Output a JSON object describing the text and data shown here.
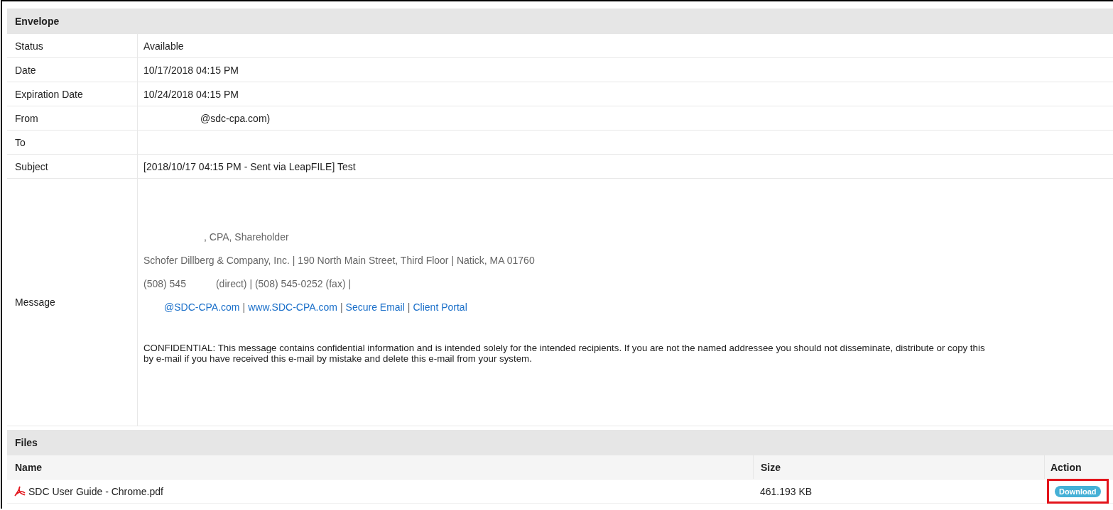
{
  "envelope": {
    "title": "Envelope",
    "fields": [
      {
        "label": "Status",
        "value": "Available",
        "indent": false
      },
      {
        "label": "Date",
        "value": "10/17/2018 04:15 PM",
        "indent": false
      },
      {
        "label": "Expiration Date",
        "value": "10/24/2018 04:15 PM",
        "indent": false
      },
      {
        "label": "From",
        "value": "@sdc-cpa.com)",
        "indent": true
      },
      {
        "label": "To"
      },
      {
        "label": "Subject",
        "value": "[2018/10/17 04:15 PM - Sent via LeapFILE] Test",
        "indent": false
      }
    ],
    "message": {
      "label": "Message",
      "title_line": ", CPA, Shareholder",
      "company_line": "Schofer Dillberg & Company, Inc. | 190 North Main Street, Third Floor | Natick, MA 01760",
      "phone_parts": [
        "(508) 545",
        "(direct) | (508) 545-0252 (fax) |"
      ],
      "links_line": [
        {
          "kind": "link",
          "text": "@SDC-CPA.com"
        },
        {
          "kind": "sep",
          "text": "|"
        },
        {
          "kind": "link",
          "text": "www.SDC-CPA.com"
        },
        {
          "kind": "sep",
          "text": "|"
        },
        {
          "kind": "link",
          "text": "Secure Email"
        },
        {
          "kind": "sep",
          "text": "|"
        },
        {
          "kind": "link",
          "text": "Client Portal"
        }
      ],
      "confidential": [
        "CONFIDENTIAL: This message contains confidential information and is intended solely for the intended recipients. If you are not the named addressee you should not disseminate, distribute or copy this",
        "by e-mail if you have received this e-mail by mistake and delete this e-mail from your system."
      ]
    }
  },
  "files": {
    "title": "Files",
    "columns": [
      "Name",
      "Size",
      "Action"
    ],
    "rows": [
      {
        "name": "SDC User Guide - Chrome.pdf",
        "size": "461.193 KB",
        "action": "Download",
        "highlighted": true
      }
    ]
  }
}
